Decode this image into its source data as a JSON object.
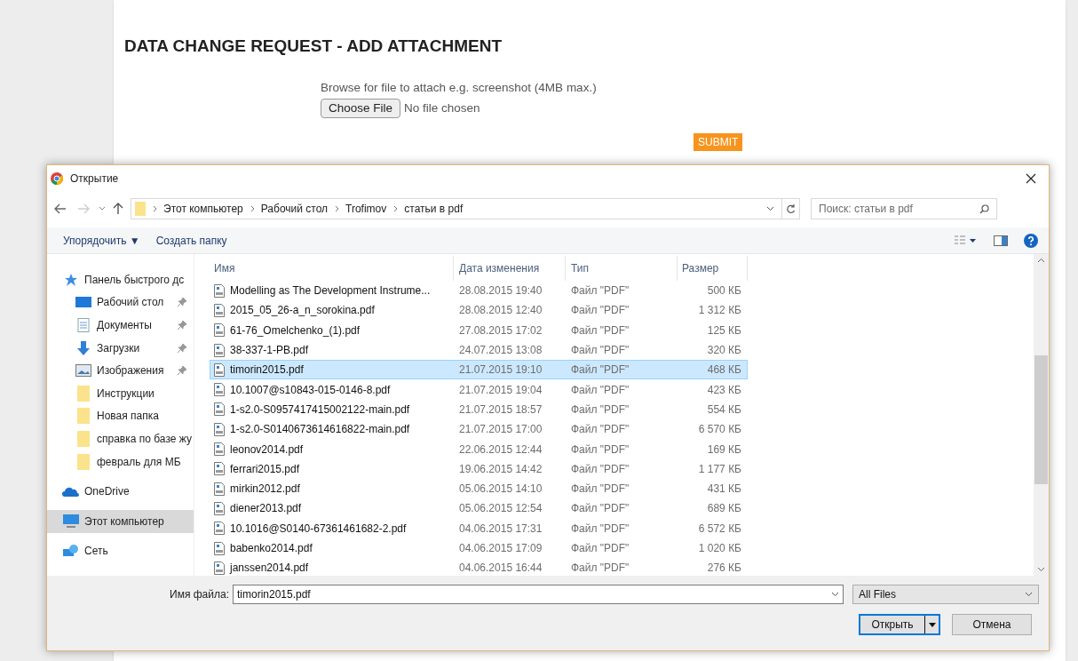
{
  "page": {
    "title": "DATA CHANGE REQUEST - ADD ATTACHMENT",
    "browse_label": "Browse for file to attach e.g. screenshot (4MB max.)",
    "choose_button": "Choose File",
    "no_file": "No file chosen",
    "submit": "SUBMIT"
  },
  "dialog": {
    "title": "Открытие",
    "breadcrumb": [
      "Этот компьютер",
      "Рабочий стол",
      "Trofimov",
      "статьи в pdf"
    ],
    "search": {
      "placeholder": "Поиск: статьи в pdf"
    },
    "toolbar": {
      "organize": "Упорядочить ▼",
      "new_folder": "Создать папку"
    },
    "sidebar": [
      {
        "label": "Панель быстрого дс",
        "kind": "star",
        "selected": false,
        "children": [
          {
            "label": "Рабочий стол",
            "kind": "desktop",
            "pinned": true,
            "selected": false
          },
          {
            "label": "Документы",
            "kind": "documents",
            "pinned": true,
            "selected": false
          },
          {
            "label": "Загрузки",
            "kind": "downloads",
            "pinned": true,
            "selected": false
          },
          {
            "label": "Изображения",
            "kind": "pictures",
            "pinned": true,
            "selected": false
          },
          {
            "label": "Инструкции",
            "kind": "folder",
            "pinned": false,
            "selected": false
          },
          {
            "label": "Новая папка",
            "kind": "folder",
            "pinned": false,
            "selected": false
          },
          {
            "label": "справка по базе жу",
            "kind": "folder",
            "pinned": false,
            "selected": false
          },
          {
            "label": "февраль для МБ",
            "kind": "folder",
            "pinned": false,
            "selected": false
          }
        ]
      },
      {
        "label": "OneDrive",
        "kind": "cloud",
        "selected": false
      },
      {
        "label": "Этот компьютер",
        "kind": "computer",
        "selected": true
      },
      {
        "label": "Сеть",
        "kind": "network",
        "selected": false
      }
    ],
    "columns": [
      "Имя",
      "Дата изменения",
      "Тип",
      "Размер"
    ],
    "files": [
      {
        "name": "Modelling as The Development Instrume...",
        "date": "28.08.2015 19:40",
        "type": "Файл \"PDF\"",
        "size": "500 КБ",
        "selected": false
      },
      {
        "name": "2015_05_26-a_n_sorokina.pdf",
        "date": "28.08.2015 12:40",
        "type": "Файл \"PDF\"",
        "size": "1 312 КБ",
        "selected": false
      },
      {
        "name": "61-76_Omelchenko_(1).pdf",
        "date": "27.08.2015 17:02",
        "type": "Файл \"PDF\"",
        "size": "125 КБ",
        "selected": false
      },
      {
        "name": "38-337-1-PB.pdf",
        "date": "24.07.2015 13:08",
        "type": "Файл \"PDF\"",
        "size": "320 КБ",
        "selected": false
      },
      {
        "name": "timorin2015.pdf",
        "date": "21.07.2015 19:10",
        "type": "Файл \"PDF\"",
        "size": "468 КБ",
        "selected": true
      },
      {
        "name": "10.1007@s10843-015-0146-8.pdf",
        "date": "21.07.2015 19:04",
        "type": "Файл \"PDF\"",
        "size": "423 КБ",
        "selected": false
      },
      {
        "name": "1-s2.0-S0957417415002122-main.pdf",
        "date": "21.07.2015 18:57",
        "type": "Файл \"PDF\"",
        "size": "554 КБ",
        "selected": false
      },
      {
        "name": "1-s2.0-S0140673614616822-main.pdf",
        "date": "21.07.2015 17:00",
        "type": "Файл \"PDF\"",
        "size": "6 570 КБ",
        "selected": false
      },
      {
        "name": "leonov2014.pdf",
        "date": "22.06.2015 12:44",
        "type": "Файл \"PDF\"",
        "size": "169 КБ",
        "selected": false
      },
      {
        "name": "ferrari2015.pdf",
        "date": "19.06.2015 14:42",
        "type": "Файл \"PDF\"",
        "size": "1 177 КБ",
        "selected": false
      },
      {
        "name": "mirkin2012.pdf",
        "date": "05.06.2015 14:10",
        "type": "Файл \"PDF\"",
        "size": "431 КБ",
        "selected": false
      },
      {
        "name": "diener2013.pdf",
        "date": "05.06.2015 12:54",
        "type": "Файл \"PDF\"",
        "size": "689 КБ",
        "selected": false
      },
      {
        "name": "10.1016@S0140-67361461682-2.pdf",
        "date": "04.06.2015 17:31",
        "type": "Файл \"PDF\"",
        "size": "6 572 КБ",
        "selected": false
      },
      {
        "name": "babenko2014.pdf",
        "date": "04.06.2015 17:09",
        "type": "Файл \"PDF\"",
        "size": "1 020 КБ",
        "selected": false
      },
      {
        "name": "janssen2014.pdf",
        "date": "04.06.2015 16:44",
        "type": "Файл \"PDF\"",
        "size": "276 КБ",
        "selected": false
      }
    ],
    "filename_label": "Имя файла:",
    "filename": "timorin2015.pdf",
    "filter": "All Files",
    "open_button": "Открыть",
    "cancel_button": "Отмена"
  }
}
